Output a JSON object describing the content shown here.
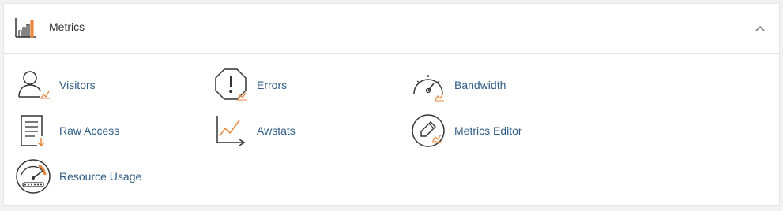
{
  "section": {
    "title": "Metrics",
    "icon": "bar-chart-icon",
    "collapse_icon": "chevron-up-icon"
  },
  "colors": {
    "accent_orange": "#e8863c",
    "link_blue": "#2f5d87",
    "highlight_yellow": "#f5f06a"
  },
  "items": [
    {
      "label": "Visitors",
      "icon": "visitors-icon"
    },
    {
      "label": "Errors",
      "icon": "errors-icon"
    },
    {
      "label": "Bandwidth",
      "icon": "bandwidth-icon"
    },
    {
      "label": "Raw Access",
      "icon": "raw-access-icon"
    },
    {
      "label": "Awstats",
      "icon": "awstats-icon"
    },
    {
      "label": "Metrics Editor",
      "icon": "metrics-editor-icon"
    },
    {
      "label": "Resource Usage",
      "icon": "resource-usage-icon"
    }
  ]
}
